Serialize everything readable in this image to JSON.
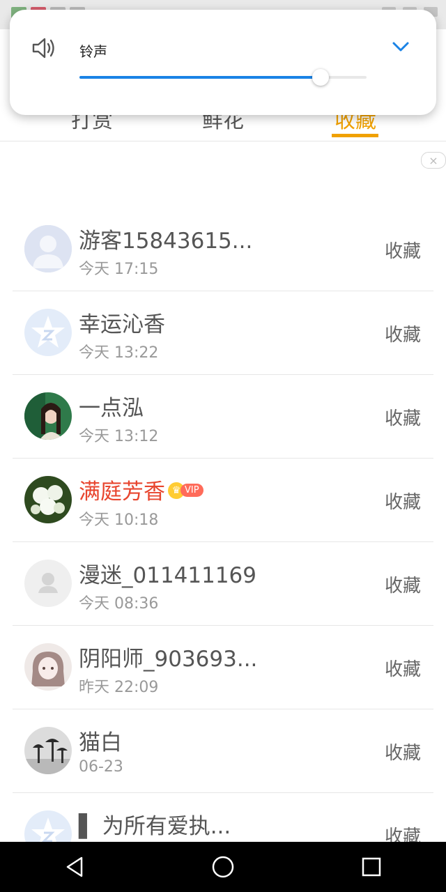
{
  "volume": {
    "label": "铃声",
    "level_percent": 84,
    "accent": "#1a83e6"
  },
  "tabs": [
    {
      "label": "打赏",
      "active": false
    },
    {
      "label": "鲜花",
      "active": false
    },
    {
      "label": "收藏",
      "active": true
    }
  ],
  "close_label": "×",
  "items": [
    {
      "name": "游客15843615...",
      "time": "今天 17:15",
      "action": "收藏",
      "avatar": "default-person-avatar"
    },
    {
      "name": "幸运沁香",
      "time": "今天 13:22",
      "action": "收藏",
      "avatar": "qzone-star-avatar"
    },
    {
      "name": "一点泓",
      "time": "今天 13:12",
      "action": "收藏",
      "avatar": "photo-woman-avatar"
    },
    {
      "name": "满庭芳香",
      "time": "今天 10:18",
      "action": "收藏",
      "avatar": "photo-flowers-avatar",
      "vip": true,
      "vip_label": "VIP"
    },
    {
      "name": "漫迷_011411169",
      "time": "今天 08:36",
      "action": "收藏",
      "avatar": "default-gray-avatar"
    },
    {
      "name": "阴阳师_903693...",
      "time": "昨天 22:09",
      "action": "收藏",
      "avatar": "anime-girl-avatar"
    },
    {
      "name": "猫白",
      "time": "06-23",
      "action": "收藏",
      "avatar": "photo-umbrellas-avatar"
    },
    {
      "name": "▌ 为所有爱执...",
      "time": "",
      "action": "收藏",
      "avatar": "qzone-star-avatar"
    }
  ],
  "colors": {
    "active_tab": "#f0a100",
    "vip_name": "#e8452e"
  }
}
